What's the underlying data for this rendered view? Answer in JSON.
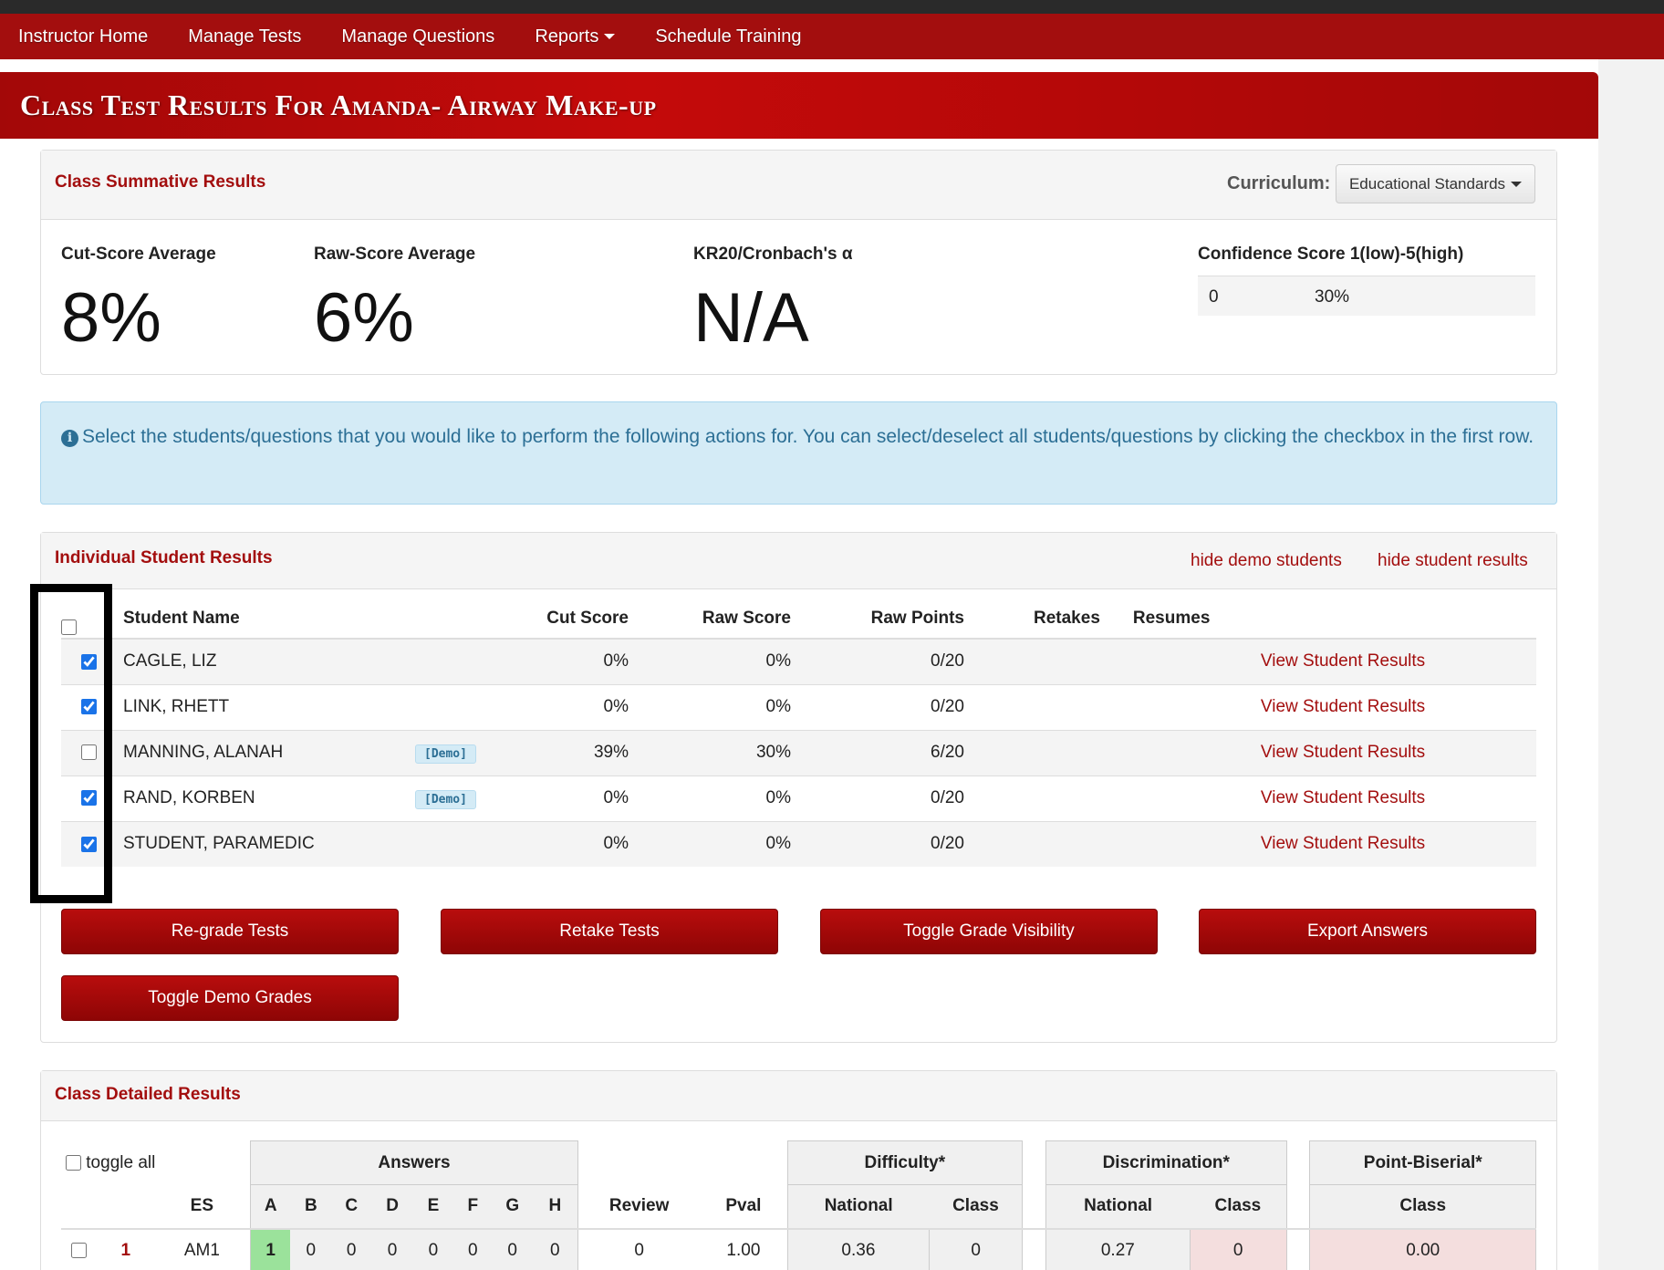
{
  "nav": {
    "items": [
      {
        "label": "Instructor Home"
      },
      {
        "label": "Manage Tests"
      },
      {
        "label": "Manage Questions"
      },
      {
        "label": "Reports",
        "dropdown": true
      },
      {
        "label": "Schedule Training"
      }
    ]
  },
  "page": {
    "title": "Class Test Results For Amanda- Airway Make-up"
  },
  "summary": {
    "title": "Class Summative Results",
    "curriculum_label": "Curriculum:",
    "curriculum_value": "Educational Standards",
    "cut_label": "Cut-Score Average",
    "cut_value": "8%",
    "raw_label": "Raw-Score Average",
    "raw_value": "6%",
    "kr_label": "KR20/Cronbach's α",
    "kr_value": "N/A",
    "conf_label": "Confidence Score 1(low)-5(high)",
    "conf_score": "0",
    "conf_pct": "30%"
  },
  "alert": {
    "text": "Select the students/questions that you would like to perform the following actions for. You can select/deselect all students/questions by clicking the checkbox in the first row."
  },
  "students_panel": {
    "title": "Individual Student Results",
    "hide_demo": "hide demo students",
    "hide_results": "hide student results",
    "headers": {
      "name": "Student Name",
      "cut": "Cut Score",
      "raw": "Raw Score",
      "points": "Raw Points",
      "retakes": "Retakes",
      "resumes": "Resumes"
    },
    "view_label": "View Student Results",
    "demo_badge": "[Demo]",
    "rows": [
      {
        "name": "CAGLE, LIZ",
        "cut": "0%",
        "raw": "0%",
        "points": "0/20",
        "checked": true,
        "demo": false
      },
      {
        "name": "LINK, RHETT",
        "cut": "0%",
        "raw": "0%",
        "points": "0/20",
        "checked": true,
        "demo": false
      },
      {
        "name": "MANNING, ALANAH",
        "cut": "39%",
        "raw": "30%",
        "points": "6/20",
        "checked": false,
        "demo": true
      },
      {
        "name": "RAND, KORBEN",
        "cut": "0%",
        "raw": "0%",
        "points": "0/20",
        "checked": true,
        "demo": true
      },
      {
        "name": "STUDENT, PARAMEDIC",
        "cut": "0%",
        "raw": "0%",
        "points": "0/20",
        "checked": true,
        "demo": false
      }
    ],
    "buttons": {
      "regrade": "Re-grade Tests",
      "retake": "Retake Tests",
      "toggle_vis": "Toggle Grade Visibility",
      "export": "Export Answers",
      "toggle_demo": "Toggle Demo Grades"
    }
  },
  "detail": {
    "title": "Class Detailed Results",
    "toggle_all": "toggle all",
    "groups": {
      "answers": "Answers",
      "difficulty": "Difficulty*",
      "discrimination": "Discrimination*",
      "pointbiserial": "Point-Biserial*"
    },
    "cols": {
      "es": "ES",
      "letters": [
        "A",
        "B",
        "C",
        "D",
        "E",
        "F",
        "G",
        "H"
      ],
      "review": "Review",
      "pval": "Pval",
      "national": "National",
      "class": "Class"
    },
    "row1": {
      "index": "1",
      "es": "AM1",
      "answers": [
        "1",
        "0",
        "0",
        "0",
        "0",
        "0",
        "0",
        "0"
      ],
      "review": "0",
      "pval": "1.00",
      "diff_national": "0.36",
      "diff_class": "0",
      "disc_national": "0.27",
      "disc_class": "0",
      "pb_class": "0.00"
    }
  },
  "colors": {
    "brand_red": "#a30e0e",
    "info_blue": "#d4ebf6",
    "correct_green": "#9be29b"
  }
}
